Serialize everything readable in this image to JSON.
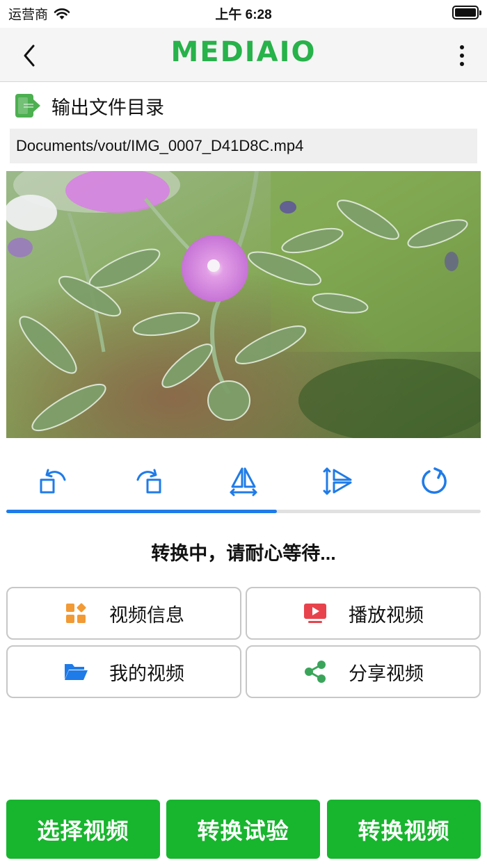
{
  "status_bar": {
    "carrier": "运营商",
    "time": "上午 6:28",
    "battery_level": 1.0,
    "icons": [
      "wifi-icon",
      "battery-icon"
    ]
  },
  "header": {
    "title": "MEDIAIO",
    "title_color": "#27b24a",
    "icons": [
      "back-icon",
      "more-icon"
    ]
  },
  "output": {
    "label": "输出文件目录",
    "path": "Documents/vout/IMG_0007_D41D8C.mp4",
    "icon": "export-icon"
  },
  "toolbar": {
    "tools": [
      {
        "name": "rotate-left-icon"
      },
      {
        "name": "rotate-right-icon"
      },
      {
        "name": "flip-horizontal-icon"
      },
      {
        "name": "flip-vertical-icon"
      },
      {
        "name": "reset-icon"
      }
    ],
    "accent": "#1f7be8",
    "progress": 0.57
  },
  "status_message": "转换中，请耐心等待...",
  "actions": [
    {
      "label": "视频信息",
      "icon": "grid-icon",
      "color": "#f29a35"
    },
    {
      "label": "播放视频",
      "icon": "play-video-icon",
      "color": "#e8434c"
    },
    {
      "label": "我的视频",
      "icon": "folder-icon",
      "color": "#1f7be8"
    },
    {
      "label": "分享视频",
      "icon": "share-icon",
      "color": "#3aa55a"
    }
  ],
  "bottom_buttons": [
    {
      "label": "选择视频"
    },
    {
      "label": "转换试验"
    },
    {
      "label": "转换视频"
    }
  ],
  "bottom_color": "#18b52e"
}
